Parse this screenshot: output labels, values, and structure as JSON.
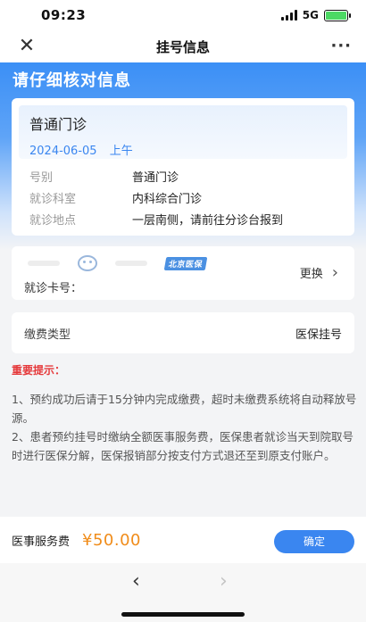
{
  "status": {
    "time": "09:23",
    "network": "5G"
  },
  "nav": {
    "close_icon": "✕",
    "title": "挂号信息",
    "more_icon": "···"
  },
  "header": {
    "title": "请仔细核对信息"
  },
  "appointment": {
    "type": "普通门诊",
    "date": "2024-06-05",
    "period": "上午",
    "rows": [
      {
        "label": "号别",
        "value": "普通门诊"
      },
      {
        "label": "就诊科室",
        "value": "内科综合门诊"
      },
      {
        "label": "就诊地点",
        "value": "一层南侧，请前往分诊台报到"
      }
    ]
  },
  "card": {
    "badge": "北京医保",
    "card_no_label": "就诊卡号：",
    "change_label": "更换"
  },
  "fee": {
    "label": "缴费类型",
    "value": "医保挂号"
  },
  "notice": {
    "title": "重要提示：",
    "items": [
      "1、预约成功后请于15分钟内完成缴费，超时未缴费系统将自动释放号源。",
      "2、患者预约挂号时缴纳全额医事服务费，医保患者就诊当天到院取号时进行医保分解，医保报销部分按支付方式退还至到原支付账户。"
    ]
  },
  "bottom": {
    "label": "医事服务费",
    "price": "¥50.00",
    "confirm": "确定"
  },
  "browser": {
    "back_icon": "‹",
    "forward_icon": "›"
  }
}
